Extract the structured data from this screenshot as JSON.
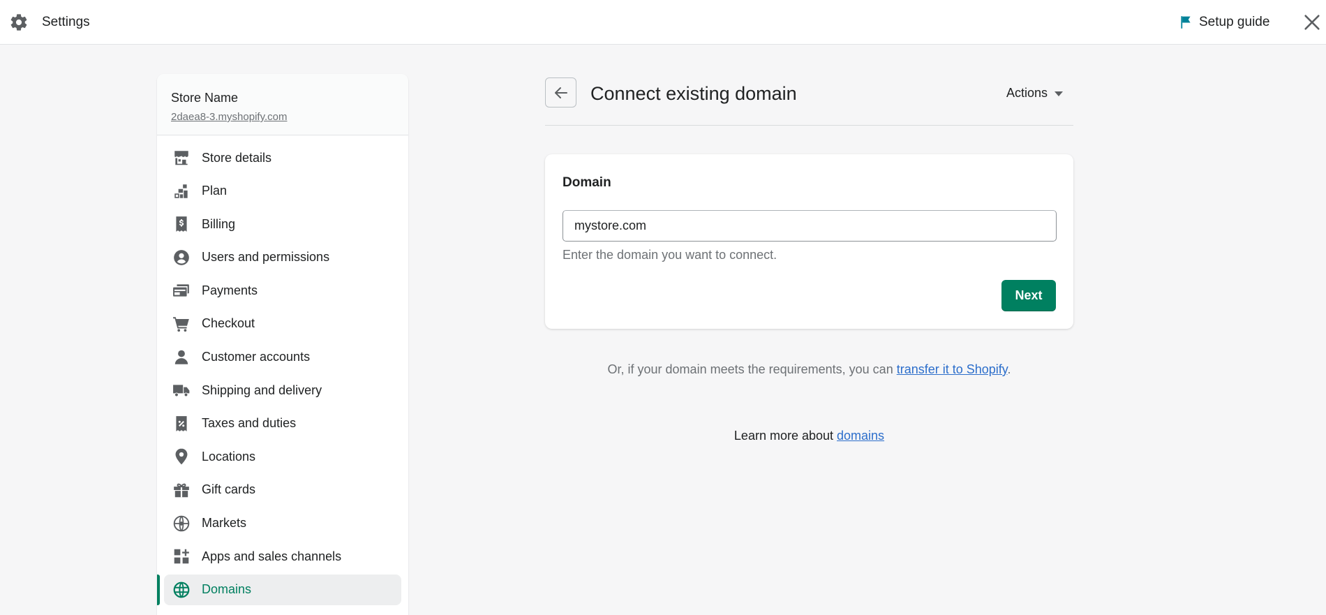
{
  "topbar": {
    "title": "Settings",
    "setup_guide": "Setup guide",
    "icons": {
      "settings": "gear-icon",
      "setup": "flag-icon",
      "close": "close-icon"
    },
    "flag_color": "#008299"
  },
  "store": {
    "name": "Store Name",
    "url": "2daea8-3.myshopify.com"
  },
  "sidebar": {
    "items": [
      {
        "label": "Store details",
        "icon": "store-icon"
      },
      {
        "label": "Plan",
        "icon": "plan-icon"
      },
      {
        "label": "Billing",
        "icon": "billing-icon"
      },
      {
        "label": "Users and permissions",
        "icon": "user-circle-icon"
      },
      {
        "label": "Payments",
        "icon": "payments-icon"
      },
      {
        "label": "Checkout",
        "icon": "cart-icon"
      },
      {
        "label": "Customer accounts",
        "icon": "person-icon"
      },
      {
        "label": "Shipping and delivery",
        "icon": "truck-icon"
      },
      {
        "label": "Taxes and duties",
        "icon": "tax-receipt-icon"
      },
      {
        "label": "Locations",
        "icon": "location-pin-icon"
      },
      {
        "label": "Gift cards",
        "icon": "gift-icon"
      },
      {
        "label": "Markets",
        "icon": "markets-globe-icon"
      },
      {
        "label": "Apps and sales channels",
        "icon": "apps-icon"
      },
      {
        "label": "Domains",
        "icon": "globe-icon",
        "active": true
      }
    ],
    "active_color": "#007f5f"
  },
  "main": {
    "title": "Connect existing domain",
    "actions_label": "Actions",
    "card": {
      "title": "Domain",
      "input_value": "mystore.com",
      "help_text": "Enter the domain you want to connect.",
      "next_label": "Next"
    },
    "transfer": {
      "prefix": "Or, if your domain meets the requirements, you can ",
      "link": "transfer it to Shopify",
      "suffix": "."
    },
    "learn": {
      "prefix": "Learn more about ",
      "link": "domains"
    }
  },
  "colors": {
    "primary_button": "#008060",
    "link": "#2c6ecb",
    "background": "#f6f6f7"
  }
}
